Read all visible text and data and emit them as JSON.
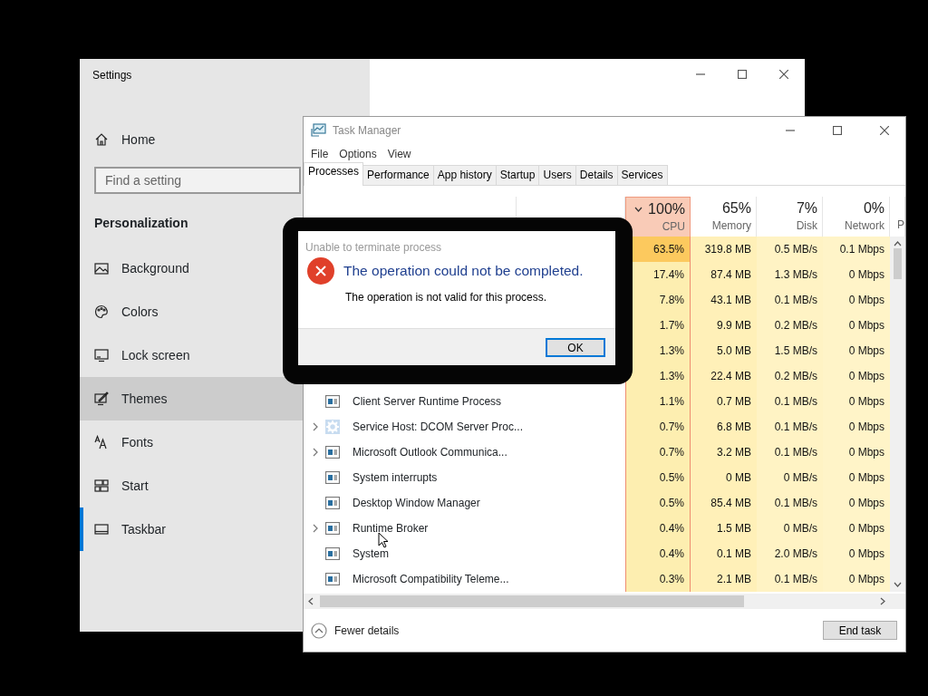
{
  "settings": {
    "title": "Settings",
    "home": "Home",
    "search": {
      "placeholder": "Find a setting"
    },
    "section": "Personalization",
    "items": [
      {
        "label": "Background",
        "selected": false,
        "hovered": false
      },
      {
        "label": "Colors",
        "selected": false,
        "hovered": false
      },
      {
        "label": "Lock screen",
        "selected": false,
        "hovered": false
      },
      {
        "label": "Themes",
        "selected": false,
        "hovered": true
      },
      {
        "label": "Fonts",
        "selected": false,
        "hovered": false
      },
      {
        "label": "Start",
        "selected": false,
        "hovered": false
      },
      {
        "label": "Taskbar",
        "selected": true,
        "hovered": false
      }
    ]
  },
  "task_manager": {
    "title": "Task Manager",
    "menu": [
      "File",
      "Options",
      "View"
    ],
    "tabs": [
      {
        "label": "Processes",
        "selected": true
      },
      {
        "label": "Performance",
        "selected": false
      },
      {
        "label": "App history",
        "selected": false
      },
      {
        "label": "Startup",
        "selected": false
      },
      {
        "label": "Users",
        "selected": false
      },
      {
        "label": "Details",
        "selected": false
      },
      {
        "label": "Services",
        "selected": false
      }
    ],
    "columns": [
      {
        "pct": "100%",
        "label": "CPU",
        "sorted": true
      },
      {
        "pct": "65%",
        "label": "Memory",
        "sorted": false
      },
      {
        "pct": "7%",
        "label": "Disk",
        "sorted": false
      },
      {
        "pct": "0%",
        "label": "Network",
        "sorted": false
      },
      {
        "label": "P",
        "sorted": false
      }
    ],
    "rows": [
      {
        "cpu": "63.5%",
        "memory": "319.8 MB",
        "disk": "0.5 MB/s",
        "network": "0.1 Mbps",
        "cpu_hot": true
      },
      {
        "cpu": "17.4%",
        "memory": "87.4 MB",
        "disk": "1.3 MB/s",
        "network": "0 Mbps",
        "cpu_hot": false
      },
      {
        "cpu": "7.8%",
        "memory": "43.1 MB",
        "disk": "0.1 MB/s",
        "network": "0 Mbps",
        "cpu_hot": false
      },
      {
        "cpu": "1.7%",
        "memory": "9.9 MB",
        "disk": "0.2 MB/s",
        "network": "0 Mbps",
        "cpu_hot": false
      },
      {
        "cpu": "1.3%",
        "memory": "5.0 MB",
        "disk": "1.5 MB/s",
        "network": "0 Mbps",
        "cpu_hot": false
      },
      {
        "cpu": "1.3%",
        "memory": "22.4 MB",
        "disk": "0.2 MB/s",
        "network": "0 Mbps",
        "cpu_hot": false
      },
      {
        "name": "Client Server Runtime Process",
        "kind": "app",
        "expandable": false,
        "cpu": "1.1%",
        "memory": "0.7 MB",
        "disk": "0.1 MB/s",
        "network": "0 Mbps",
        "cpu_hot": false
      },
      {
        "name": "Service Host: DCOM Server Proc...",
        "kind": "service",
        "expandable": true,
        "cpu": "0.7%",
        "memory": "6.8 MB",
        "disk": "0.1 MB/s",
        "network": "0 Mbps",
        "cpu_hot": false
      },
      {
        "name": "Microsoft Outlook Communica...",
        "kind": "app",
        "expandable": true,
        "cpu": "0.7%",
        "memory": "3.2 MB",
        "disk": "0.1 MB/s",
        "network": "0 Mbps",
        "cpu_hot": false
      },
      {
        "name": "System interrupts",
        "kind": "app",
        "expandable": false,
        "cpu": "0.5%",
        "memory": "0 MB",
        "disk": "0 MB/s",
        "network": "0 Mbps",
        "cpu_hot": false
      },
      {
        "name": "Desktop Window Manager",
        "kind": "app",
        "expandable": false,
        "cpu": "0.5%",
        "memory": "85.4 MB",
        "disk": "0.1 MB/s",
        "network": "0 Mbps",
        "cpu_hot": false
      },
      {
        "name": "Runtime Broker",
        "kind": "app",
        "expandable": true,
        "cpu": "0.4%",
        "memory": "1.5 MB",
        "disk": "0 MB/s",
        "network": "0 Mbps",
        "cpu_hot": false
      },
      {
        "name": "System",
        "kind": "app",
        "expandable": false,
        "cpu": "0.4%",
        "memory": "0.1 MB",
        "disk": "2.0 MB/s",
        "network": "0 Mbps",
        "cpu_hot": false
      },
      {
        "name": "Microsoft Compatibility Teleme...",
        "kind": "app",
        "expandable": false,
        "cpu": "0.3%",
        "memory": "2.1 MB",
        "disk": "0.1 MB/s",
        "network": "0 Mbps",
        "cpu_hot": false
      }
    ],
    "footer": {
      "details": "Fewer details",
      "end_task": "End task"
    }
  },
  "dialog": {
    "title": "Unable to terminate process",
    "heading": "The operation could not be completed.",
    "message": "The operation is not valid for this process.",
    "button": "OK"
  }
}
